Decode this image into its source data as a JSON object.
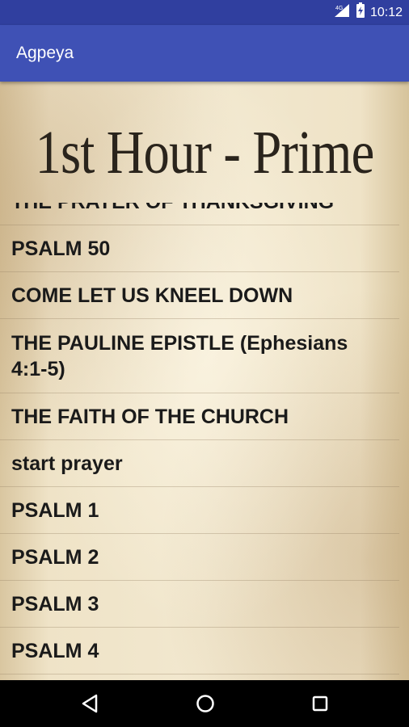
{
  "status_bar": {
    "network": "4G",
    "time": "10:12",
    "icons": [
      "signal-icon",
      "battery-icon"
    ]
  },
  "app_bar": {
    "title": "Agpeya"
  },
  "header": {
    "hour_title": "1st Hour - Prime"
  },
  "prayers": [
    {
      "label": "THE PRAYER OF THANKSGIVING"
    },
    {
      "label": "PSALM 50"
    },
    {
      "label": "COME LET US KNEEL DOWN"
    },
    {
      "label": "THE PAULINE EPISTLE (Ephesians 4:1-5)"
    },
    {
      "label": "THE FAITH OF THE CHURCH"
    },
    {
      "label": "start prayer"
    },
    {
      "label": "PSALM 1"
    },
    {
      "label": "PSALM 2"
    },
    {
      "label": "PSALM 3"
    },
    {
      "label": "PSALM 4"
    }
  ],
  "nav_bar": {
    "icons": [
      "back-icon",
      "home-icon",
      "recent-apps-icon"
    ]
  },
  "colors": {
    "status_bar": "#303f9f",
    "app_bar": "#3f51b5",
    "parchment": "#f2e8cf",
    "text": "#1a1a1a"
  }
}
